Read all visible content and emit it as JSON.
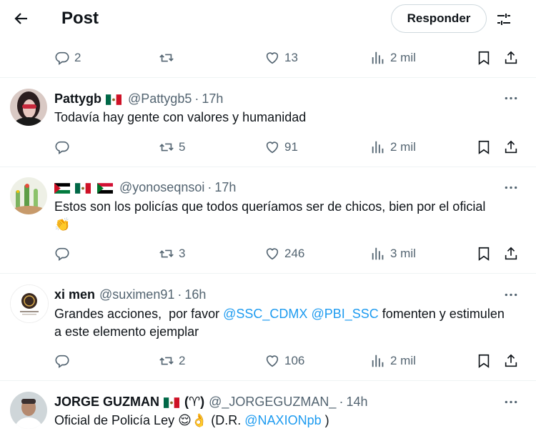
{
  "header": {
    "title": "Post",
    "reply_label": "Responder"
  },
  "top_actions": {
    "replies": "2",
    "reposts": "",
    "likes": "13",
    "views": "2 mil"
  },
  "tweets": [
    {
      "name": "Pattygb",
      "flags": [
        "mexico"
      ],
      "handle": "@Pattygb5",
      "time": "17h",
      "text": "Todavía hay gente con valores y humanidad",
      "replies": "",
      "reposts": "5",
      "likes": "91",
      "views": "2 mil"
    },
    {
      "name": "",
      "flags": [
        "palestine",
        "mexico",
        "sudan"
      ],
      "handle": "@yonoseqnsoi",
      "time": "17h",
      "text": "Estos son los policías que todos queríamos ser de chicos, bien por el oficial",
      "emoji": "👏",
      "replies": "",
      "reposts": "3",
      "likes": "246",
      "views": "3 mil"
    },
    {
      "name": "xi men",
      "flags": [],
      "handle": "@suximen91",
      "time": "16h",
      "text_before": "Grandes acciones,  por favor ",
      "mention1": "@SSC_CDMX",
      "mention2": "@PBI_SSC",
      "text_after": " fomenten y estimulen",
      "text_line2": "a este elemento ejemplar",
      "replies": "",
      "reposts": "2",
      "likes": "106",
      "views": "2 mil"
    },
    {
      "name": "JORGE GUZMAN",
      "flags": [
        "mexico"
      ],
      "name_suffix": "(♈)",
      "handle": "@_JORGEGUZMAN_",
      "time": "14h",
      "text_before": "Oficial de Policía Ley ",
      "emojis": "😌👌",
      "text_mid": " (D.R. ",
      "mention": "@NAXIONpb",
      "text_after": " )"
    }
  ],
  "icons": {
    "reply": "reply-icon",
    "repost": "repost-icon",
    "like": "heart-icon",
    "views": "views-icon",
    "bookmark": "bookmark-icon",
    "share": "share-icon"
  },
  "colors": {
    "link": "#1d9bf0",
    "muted": "#536471",
    "text": "#0f1419"
  },
  "dot": "·"
}
